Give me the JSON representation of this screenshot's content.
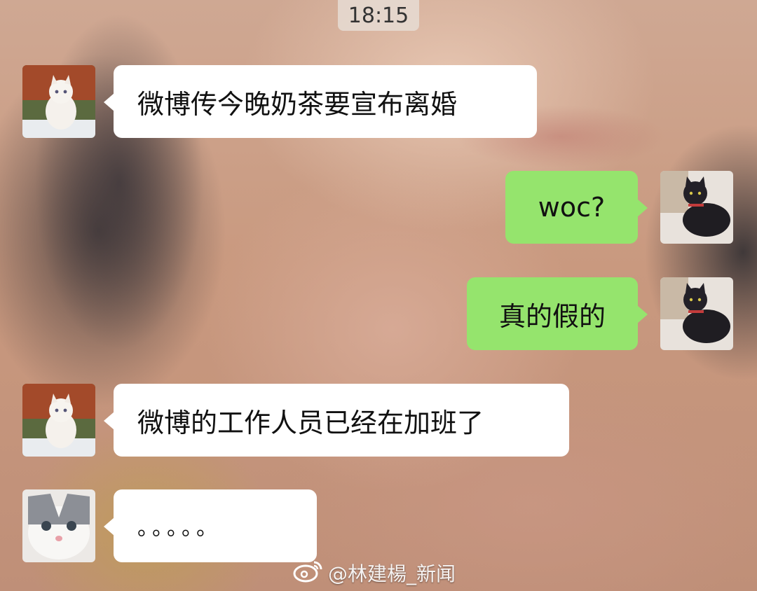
{
  "status": {
    "time": "18:15"
  },
  "messages": [
    {
      "side": "left",
      "text": "微博传今晚奶茶要宣布离婚",
      "avatar": "white-kitten-avatar"
    },
    {
      "side": "right",
      "text": "woc?",
      "avatar": "black-cat-avatar"
    },
    {
      "side": "right",
      "text": "真的假的",
      "avatar": "black-cat-avatar"
    },
    {
      "side": "left",
      "text": "微博的工作人员已经在加班了",
      "avatar": "white-kitten-avatar"
    },
    {
      "side": "left",
      "text": "。。。。。",
      "avatar": "grey-white-cat-avatar"
    }
  ],
  "watermark": {
    "text": "@林建楊_新闻",
    "icon": "weibo-icon"
  },
  "colors": {
    "sent_bubble": "#95e46d",
    "received_bubble": "#ffffff"
  }
}
